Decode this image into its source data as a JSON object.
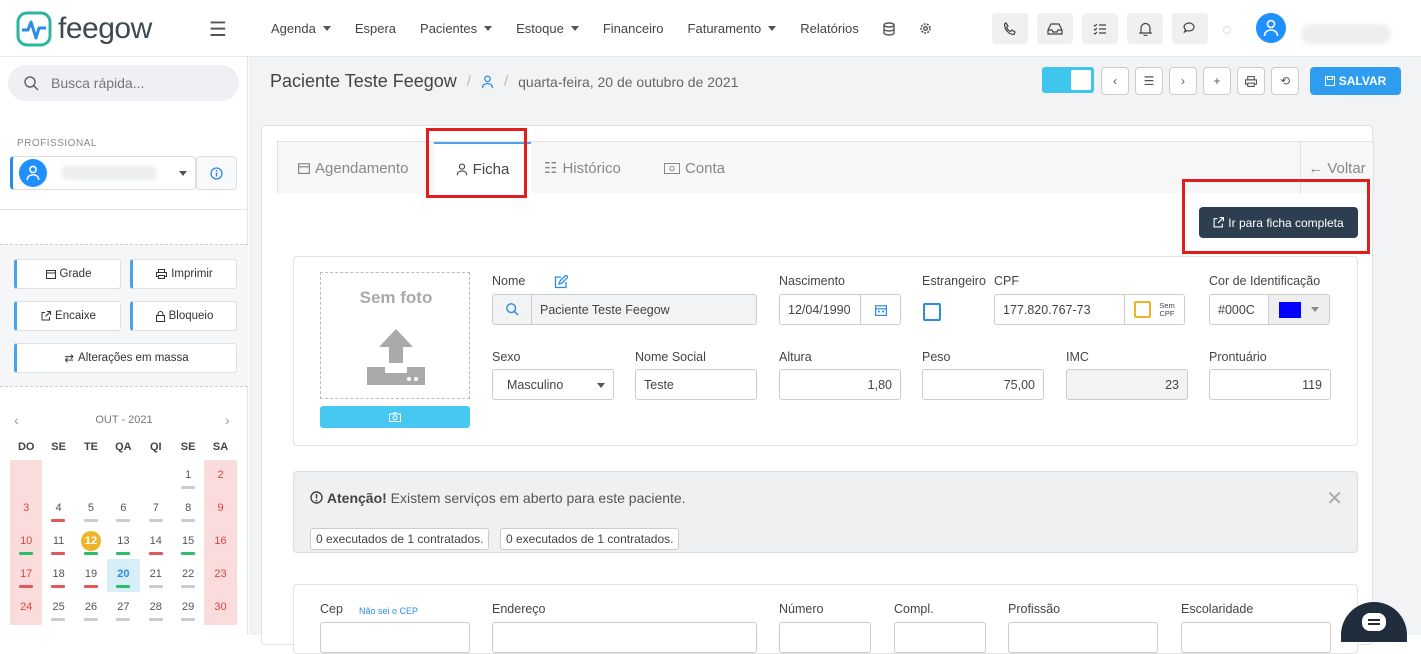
{
  "app": {
    "brand": "feegow",
    "accent": "#2e9df0"
  },
  "nav": {
    "items": [
      {
        "label": "Agenda",
        "dropdown": true
      },
      {
        "label": "Espera",
        "dropdown": false
      },
      {
        "label": "Pacientes",
        "dropdown": true
      },
      {
        "label": "Estoque",
        "dropdown": true
      },
      {
        "label": "Financeiro",
        "dropdown": false
      },
      {
        "label": "Faturamento",
        "dropdown": true
      },
      {
        "label": "Relatórios",
        "dropdown": false
      }
    ],
    "icons": [
      "database-icon",
      "gear-icon"
    ],
    "tool_icons": [
      "phone-icon",
      "inbox-icon",
      "checklist-icon",
      "bell-icon",
      "chat-icon"
    ]
  },
  "sidebar": {
    "search_placeholder": "Busca rápida...",
    "professional_label": "PROFISSIONAL",
    "buttons": {
      "grade": "Grade",
      "imprimir": "Imprimir",
      "encaixe": "Encaixe",
      "bloqueio": "Bloqueio",
      "massa": "Alterações em massa"
    },
    "calendar": {
      "title": "OUT - 2021",
      "weekdays": [
        "DO",
        "SE",
        "TE",
        "QA",
        "QI",
        "SE",
        "SA"
      ],
      "weeks": [
        [
          "",
          "",
          "",
          "",
          "",
          "1",
          "2"
        ],
        [
          "3",
          "4",
          "5",
          "6",
          "7",
          "8",
          "9"
        ],
        [
          "10",
          "11",
          "12",
          "13",
          "14",
          "15",
          "16"
        ],
        [
          "17",
          "18",
          "19",
          "20",
          "21",
          "22",
          "23"
        ],
        [
          "24",
          "25",
          "26",
          "27",
          "28",
          "29",
          "30"
        ]
      ],
      "today": "12",
      "selected": "20"
    }
  },
  "header": {
    "patient_name": "Paciente Teste Feegow",
    "separator": "/",
    "date": "quarta-feira, 20 de outubro de 2021",
    "save_label": "SALVAR"
  },
  "tabs": [
    {
      "label": "Agendamento",
      "icon": "calendar-icon"
    },
    {
      "label": "Ficha",
      "icon": "user-icon",
      "active": true
    },
    {
      "label": "Histórico",
      "icon": "list-icon"
    },
    {
      "label": "Conta",
      "icon": "money-icon"
    }
  ],
  "voltar_label": "Voltar",
  "ficha_completa_label": "Ir para ficha completa",
  "form": {
    "photo_text": "Sem foto",
    "nome_label": "Nome",
    "nome_value": "Paciente Teste Feegow",
    "nascimento_label": "Nascimento",
    "nascimento_value": "12/04/1990",
    "estrangeiro_label": "Estrangeiro",
    "cpf_label": "CPF",
    "cpf_value": "177.820.767-73",
    "sem_cpf_line1": "Sem",
    "sem_cpf_line2": "CPF",
    "cor_label": "Cor de Identificação",
    "cor_value": "#000C",
    "cor_swatch": "#0000ff",
    "sexo_label": "Sexo",
    "sexo_value": "Masculino",
    "nome_social_label": "Nome Social",
    "nome_social_value": "Teste",
    "altura_label": "Altura",
    "altura_value": "1,80",
    "peso_label": "Peso",
    "peso_value": "75,00",
    "imc_label": "IMC",
    "imc_value": "23",
    "prontuario_label": "Prontuário",
    "prontuario_value": "119"
  },
  "alert": {
    "title": "Atenção!",
    "message": " Existem serviços em aberto para este paciente.",
    "chips": [
      "0 executados de 1 contratados.",
      "0 executados de 1 contratados."
    ]
  },
  "address": {
    "cep_label": "Cep",
    "cep_link": "Não sei o CEP",
    "endereco_label": "Endereço",
    "numero_label": "Número",
    "compl_label": "Compl.",
    "profissao_label": "Profissão",
    "escolaridade_label": "Escolaridade"
  }
}
